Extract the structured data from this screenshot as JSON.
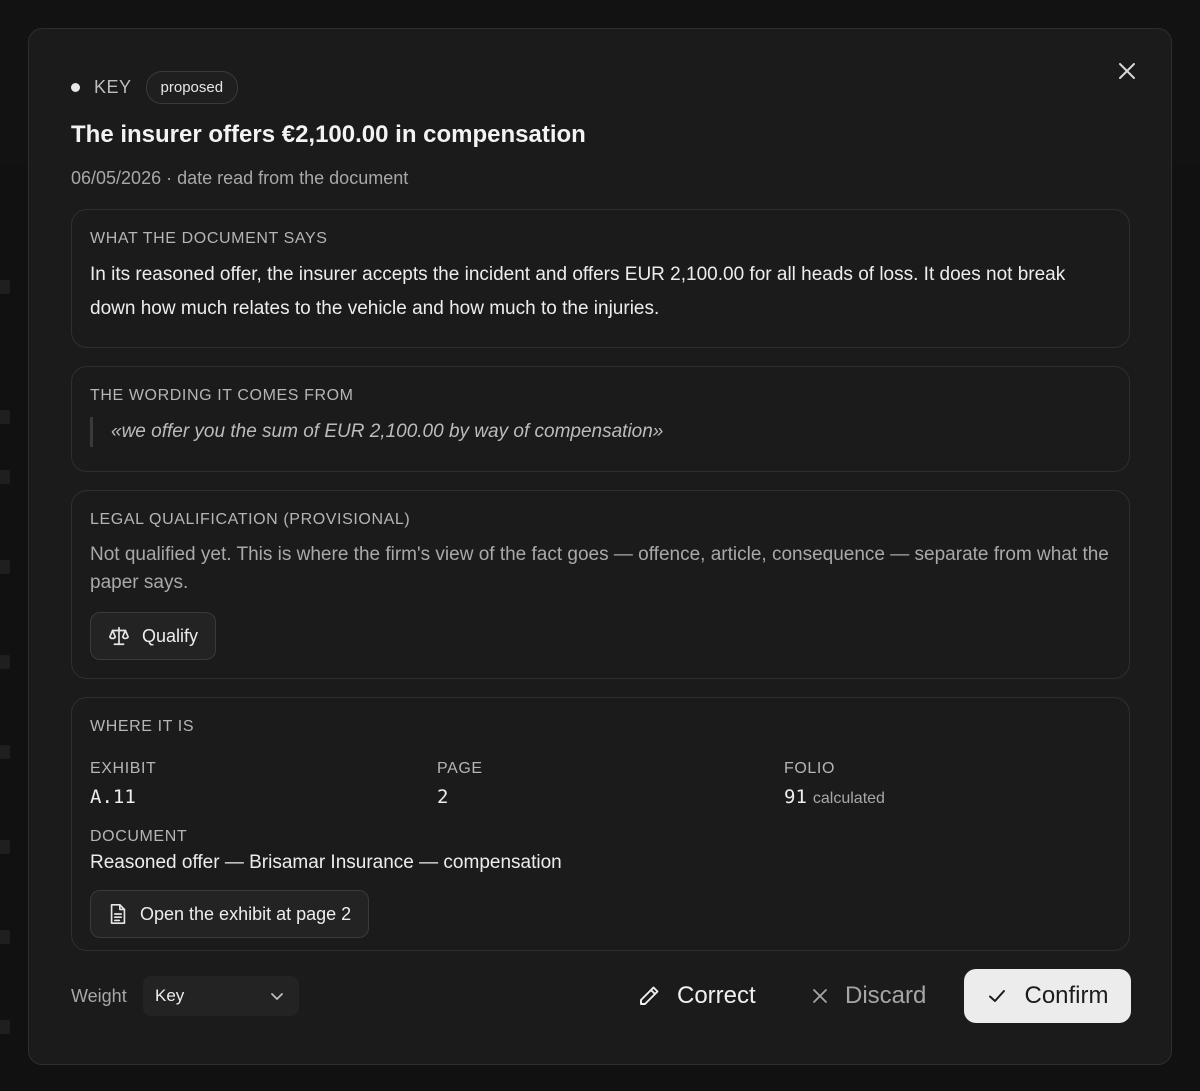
{
  "fact": {
    "weight": "KEY",
    "status_badge": "proposed",
    "title": "The insurer offers €2,100.00 in compensation",
    "subtitle": "06/05/2026 · date read from the document"
  },
  "document_says": {
    "label": "WHAT THE DOCUMENT SAYS",
    "text": "In its reasoned offer, the insurer accepts the incident and offers EUR 2,100.00 for all heads of loss. It does not break down how much relates to the vehicle and how much to the injuries."
  },
  "wording": {
    "label": "THE WORDING IT COMES FROM",
    "quote": "«we offer you the sum of EUR 2,100.00 by way of compensation»"
  },
  "qualification": {
    "label": "LEGAL QUALIFICATION (PROVISIONAL)",
    "text": "Not qualified yet. This is where the firm's view of the fact goes — offence, article, consequence — separate from what the paper says.",
    "button_label": "Qualify",
    "button_icon": "scale-icon"
  },
  "location": {
    "label": "WHERE IT IS",
    "exhibit_label": "EXHIBIT",
    "exhibit_value": "A.11",
    "page_label": "PAGE",
    "page_value": "2",
    "folio_label": "FOLIO",
    "folio_value": "91",
    "folio_note": "calculated",
    "document_label": "DOCUMENT",
    "document_value": "Reasoned offer — Brisamar Insurance — compensation",
    "open_button_label": "Open the exhibit at page 2",
    "open_button_icon": "file-text-icon"
  },
  "footer": {
    "weight_label": "Weight",
    "weight_selected": "Key",
    "correct_label": "Correct",
    "discard_label": "Discard",
    "confirm_label": "Confirm"
  },
  "colors": {
    "modal_bg": "#1b1b1b",
    "card_border": "#2f2f2f",
    "confirm_bg": "#ececec",
    "text_primary": "#ededed",
    "text_muted": "#a8a8a8"
  }
}
